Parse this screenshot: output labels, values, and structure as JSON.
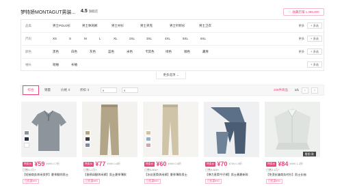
{
  "store": {
    "name": "梦特娇MONTAGUT男装...",
    "score": "4.5",
    "score_label": "旗舰店",
    "favorite_label": "收藏店铺 1,385,000"
  },
  "filters": [
    {
      "label": "品类",
      "options": [
        "男士POLO衫",
        "男士休闲裤",
        "男士衬衫",
        "男士夹克",
        "男士针织衫",
        "男士卫衣"
      ]
    },
    {
      "label": "尺码",
      "options": [
        "XS",
        "S",
        "M",
        "L",
        "XL",
        "2XL",
        "3XL",
        "4XL",
        "5XL",
        "6XL"
      ]
    },
    {
      "label": "颜色",
      "options": [
        "黑色",
        "白色",
        "灰色",
        "蓝色",
        "米色",
        "卡其色",
        "绿色",
        "咖色",
        "藏青"
      ]
    },
    {
      "label": "袖长",
      "options": [
        "短袖",
        "长袖"
      ]
    }
  ],
  "filter_actions": {
    "more": "更多",
    "multi": "+ 多选"
  },
  "more_options_label": "更多选项",
  "sort": {
    "items": [
      "综合",
      "销量",
      "价格",
      "折扣"
    ],
    "price_min_placeholder": "¥",
    "price_max_placeholder": "¥",
    "result_count": "206件商品",
    "page": "1/1",
    "prev": "<",
    "next": ">"
  },
  "products": [
    {
      "special": "特卖价",
      "price": "¥59",
      "old_price": "¥999 0.7折",
      "sold": "已售3.2万+",
      "title": "【短袖商务休闲保罗】夏季翻领男士",
      "coupon": "已优惠¥40",
      "badge": ""
    },
    {
      "special": "特卖价",
      "price": "¥77",
      "old_price": "¥999 0.8折",
      "sold": "已售1.1万+",
      "title": "【垂感阔腿休闲裤】男士夏季薄款",
      "coupon": "已优惠¥60",
      "badge": ""
    },
    {
      "special": "特卖价",
      "price": "¥60",
      "old_price": "¥999 0.6折",
      "sold": "已售5,800+",
      "title": "【冰丝直筒休闲裤】夏季薄款男士",
      "coupon": "已优惠¥40",
      "badge": ""
    },
    {
      "special": "特卖价",
      "price": "¥70",
      "old_price": "¥799 0.9折",
      "sold": "已售9,600+",
      "title": "【弹力直筒牛仔裤】男士春夏新款",
      "coupon": "已优惠¥40",
      "badge": ""
    },
    {
      "special": "特卖价",
      "price": "¥84",
      "old_price": "¥999 1.2折",
      "sold": "已售2.4万+",
      "title": "【免烫抗皱商务衬衫】男士长袖",
      "coupon": "已优惠¥40",
      "badge": "看图·款"
    }
  ]
}
